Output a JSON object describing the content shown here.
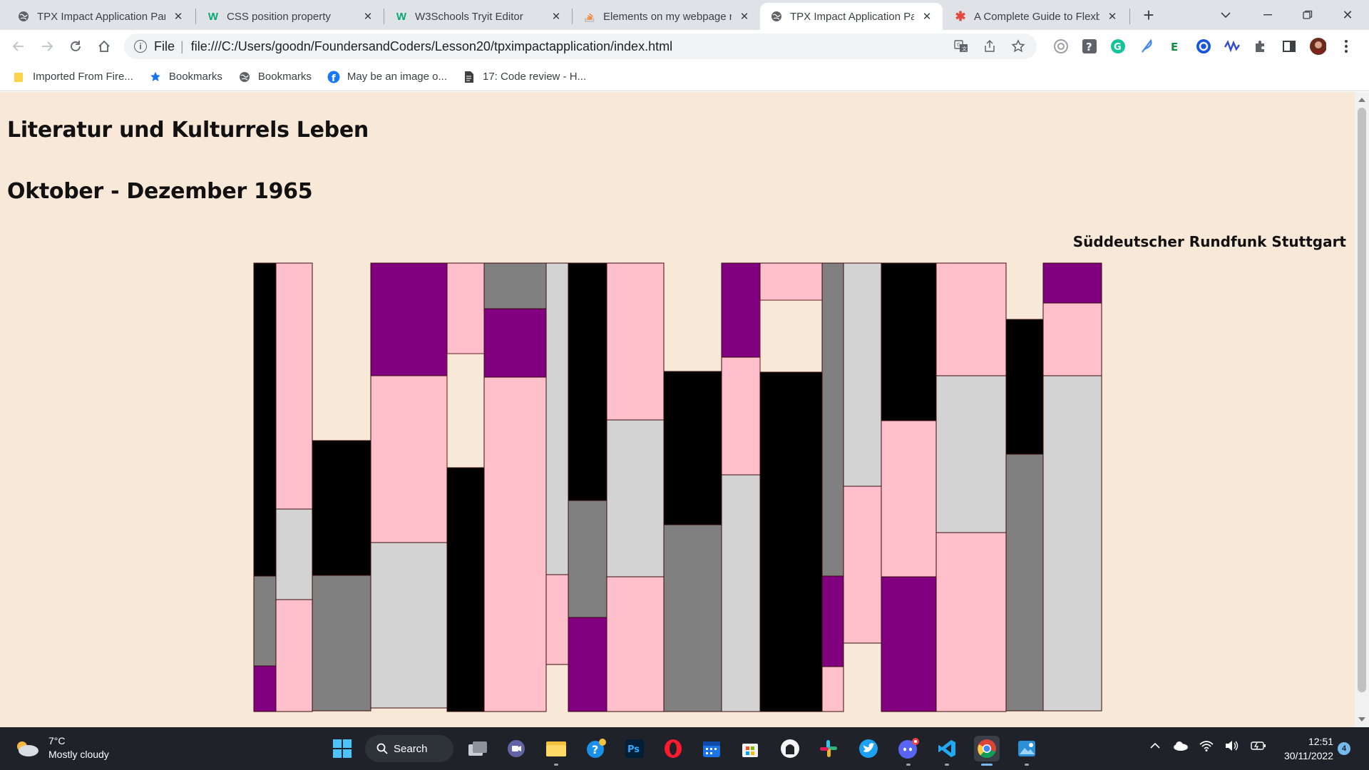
{
  "browser": {
    "tabs": [
      {
        "title": "TPX Impact Application Part",
        "icon": "globe-icon",
        "active": false
      },
      {
        "title": "CSS position property",
        "icon": "w3schools-icon",
        "active": false
      },
      {
        "title": "W3Schools Tryit Editor",
        "icon": "w3schools-icon",
        "active": false
      },
      {
        "title": "Elements on my webpage n",
        "icon": "stackoverflow-icon",
        "active": false
      },
      {
        "title": "TPX Impact Application Part",
        "icon": "globe-icon",
        "active": true
      },
      {
        "title": "A Complete Guide to Flexbo",
        "icon": "csstricks-icon",
        "active": false
      }
    ],
    "new_tab": "+",
    "address": {
      "scheme": "File",
      "url": "file:///C:/Users/goodn/FoundersandCoders/Lesson20/tpximpactapplication/index.html"
    },
    "bookmarks": [
      {
        "label": "Imported From Fire...",
        "icon": "folder-icon"
      },
      {
        "label": "Bookmarks",
        "icon": "star-icon"
      },
      {
        "label": "Bookmarks",
        "icon": "globe-icon"
      },
      {
        "label": "May be an image o...",
        "icon": "facebook-icon"
      },
      {
        "label": "17: Code review - H...",
        "icon": "document-icon"
      }
    ]
  },
  "page": {
    "heading1": "Literatur und Kulturrels Leben",
    "heading2": "Oktober - Dezember 1965",
    "station": "Süddeutscher Rundfunk Stuttgart",
    "palette": {
      "black": "#000000",
      "pink": "#ffc0cb",
      "grey": "#808080",
      "lightgrey": "#d3d3d3",
      "purple": "#800080",
      "background": "#f8e8d8"
    }
  },
  "taskbar": {
    "weather": {
      "temp": "7°C",
      "condition": "Mostly cloudy"
    },
    "search_label": "Search",
    "clock": {
      "time": "12:51",
      "date": "30/11/2022"
    },
    "notifications": "4"
  }
}
